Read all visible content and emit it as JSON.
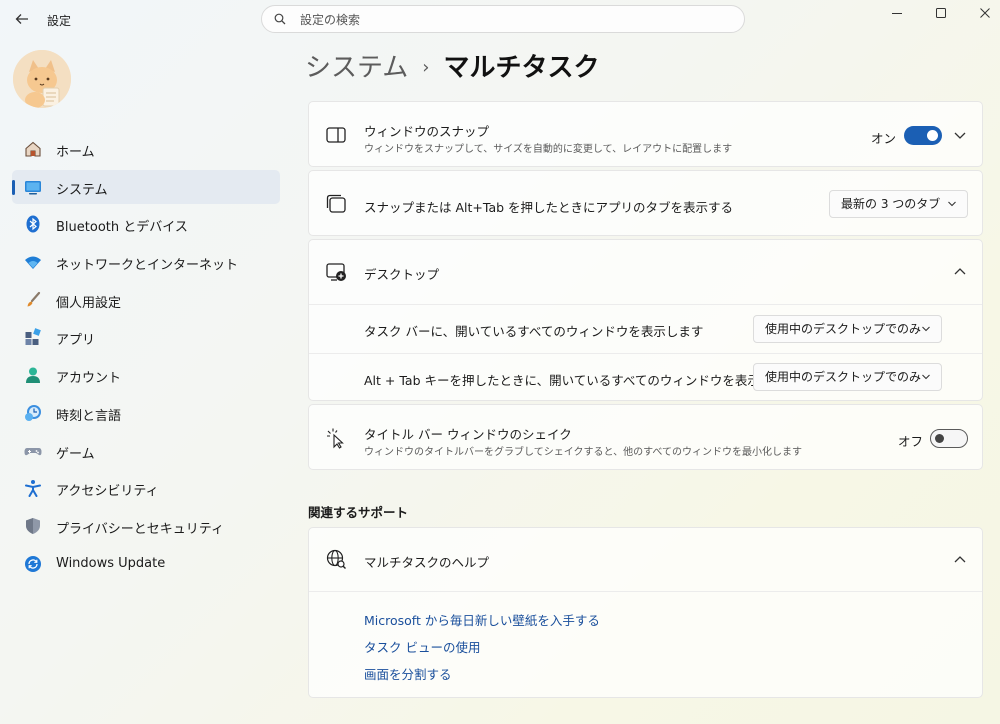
{
  "titlebar": {
    "app_title": "設定",
    "search_placeholder": "設定の検索"
  },
  "sidebar": {
    "items": [
      {
        "label": "ホーム",
        "icon": "home-icon"
      },
      {
        "label": "システム",
        "icon": "system-icon",
        "active": true
      },
      {
        "label": "Bluetooth とデバイス",
        "icon": "bluetooth-icon"
      },
      {
        "label": "ネットワークとインターネット",
        "icon": "wifi-icon"
      },
      {
        "label": "個人用設定",
        "icon": "brush-icon"
      },
      {
        "label": "アプリ",
        "icon": "apps-icon"
      },
      {
        "label": "アカウント",
        "icon": "account-icon"
      },
      {
        "label": "時刻と言語",
        "icon": "time-language-icon"
      },
      {
        "label": "ゲーム",
        "icon": "gamepad-icon"
      },
      {
        "label": "アクセシビリティ",
        "icon": "accessibility-icon"
      },
      {
        "label": "プライバシーとセキュリティ",
        "icon": "shield-icon"
      },
      {
        "label": "Windows Update",
        "icon": "windows-update-icon"
      }
    ]
  },
  "breadcrumb": {
    "parent": "システム",
    "separator": "›",
    "current": "マルチタスク"
  },
  "snap": {
    "title": "ウィンドウのスナップ",
    "subtitle": "ウィンドウをスナップして、サイズを自動的に変更して、レイアウトに配置します",
    "toggle_label": "オン"
  },
  "snap_tabs": {
    "title": "スナップまたは Alt+Tab を押したときにアプリのタブを表示する",
    "value": "最新の 3 つのタブ"
  },
  "desktop": {
    "title": "デスクトップ",
    "taskbar_label": "タスク バーに、開いているすべてのウィンドウを表示します",
    "taskbar_value": "使用中のデスクトップでのみ",
    "alttab_label": "Alt + Tab キーを押したときに、開いているすべてのウィンドウを表示する",
    "alttab_value": "使用中のデスクトップでのみ"
  },
  "shake": {
    "title": "タイトル バー ウィンドウのシェイク",
    "subtitle": "ウィンドウのタイトルバーをグラブしてシェイクすると、他のすべてのウィンドウを最小化します",
    "toggle_label": "オフ"
  },
  "support": {
    "header": "関連するサポート",
    "title": "マルチタスクのヘルプ",
    "links": [
      "Microsoft から毎日新しい壁紙を入手する",
      "タスク ビューの使用",
      "画面を分割する"
    ]
  },
  "colors": {
    "accent": "#1b5fb4",
    "link": "#1a4f9c"
  }
}
